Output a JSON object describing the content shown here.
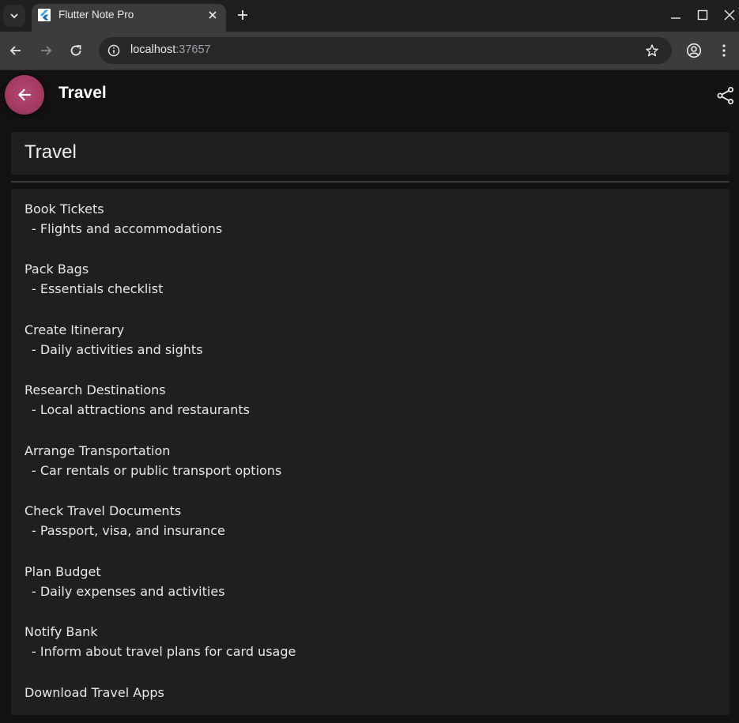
{
  "browser": {
    "tab_title": "Flutter Note Pro",
    "url_host": "localhost",
    "url_port": ":37657"
  },
  "app": {
    "appbar_title": "Travel",
    "note_title": "Travel",
    "tasks": [
      {
        "title": "Book Tickets",
        "detail": "- Flights and accommodations"
      },
      {
        "title": "Pack Bags",
        "detail": "- Essentials checklist"
      },
      {
        "title": "Create Itinerary",
        "detail": "- Daily activities and sights"
      },
      {
        "title": "Research Destinations",
        "detail": "- Local attractions and restaurants"
      },
      {
        "title": "Arrange Transportation",
        "detail": "- Car rentals or public transport options"
      },
      {
        "title": "Check Travel Documents",
        "detail": "- Passport, visa, and insurance"
      },
      {
        "title": "Plan Budget",
        "detail": "- Daily expenses and activities"
      },
      {
        "title": "Notify Bank",
        "detail": "- Inform about travel plans for card usage"
      },
      {
        "title": "Download Travel Apps",
        "detail": ""
      }
    ]
  },
  "colors": {
    "accent": "#a03a60",
    "background": "#121212",
    "card": "#1f1f1f"
  }
}
